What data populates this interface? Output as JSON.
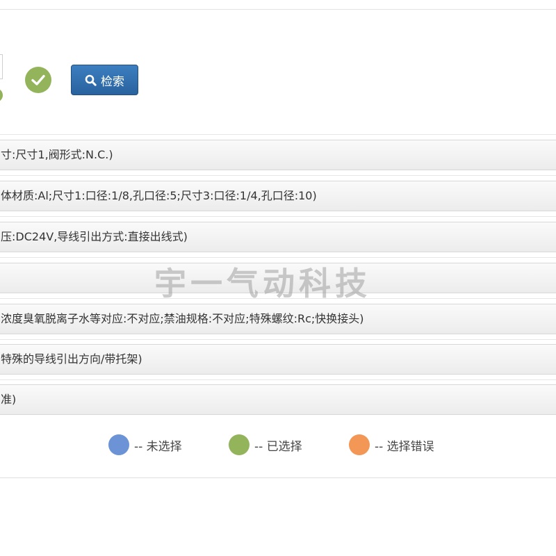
{
  "toolbar": {
    "search_label": "检索",
    "search_icon": "search-icon",
    "confirm_icon": "check-circle-icon",
    "confirm_color": "#93b45b",
    "button_color": "#2f6faf"
  },
  "spec_rows": [
    "寸:尺寸1,阀形式:N.C.)",
    "体材质:Al;尺寸1:口径:1/8,孔口径:5;尺寸3:口径:1/4,孔口径:10)",
    "压:DC24V,导线引出方式:直接出线式)",
    "",
    "浓度臭氧脱离子水等对应:不对应;禁油规格:不对应;特殊螺纹:Rc;快换接头)",
    "特殊的导线引出方向/带托架)",
    "准)"
  ],
  "watermark": "宇一气动科技",
  "legend": [
    {
      "label": "-- 未选择",
      "color": "#6b93d6"
    },
    {
      "label": "-- 已选择",
      "color": "#93b45b"
    },
    {
      "label": "-- 选择错误",
      "color": "#f29755"
    }
  ]
}
